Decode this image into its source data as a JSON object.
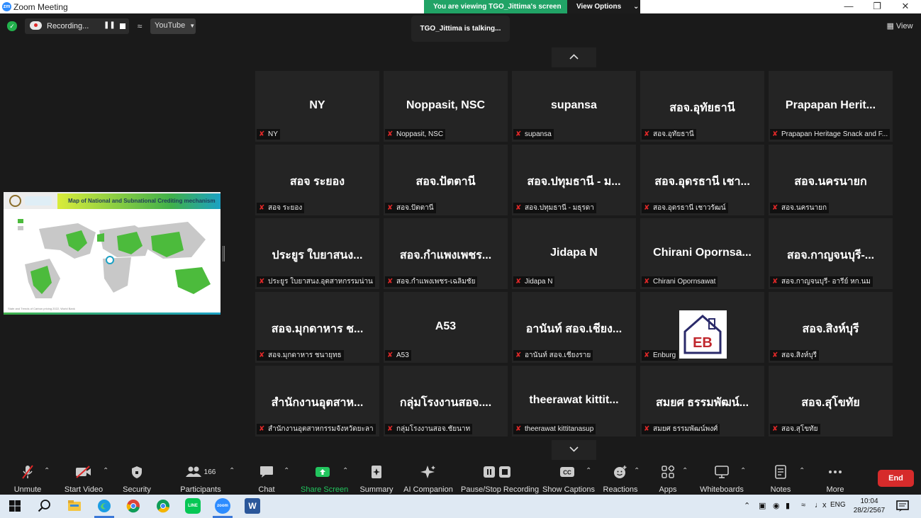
{
  "window": {
    "app_icon_text": "zm",
    "title": "Zoom Meeting"
  },
  "share_banner": {
    "message": "You are viewing TGO_Jittima's screen",
    "view_options": "View Options"
  },
  "recording": {
    "label": "Recording..."
  },
  "stream_target": {
    "label": "YouTube"
  },
  "talking_indicator": "TGO_Jittima is talking...",
  "view_button": "View",
  "shared_slide": {
    "title": "Map of National and Subnational Crediting mechanism",
    "footer": "State and Trends of Carbon pricing 2022, World Bank"
  },
  "participants_grid": [
    {
      "display": "NY",
      "name": "NY"
    },
    {
      "display": "Noppasit, NSC",
      "name": "Noppasit, NSC"
    },
    {
      "display": "supansa",
      "name": "supansa"
    },
    {
      "display": "สอจ.อุทัยธานี",
      "name": "สอจ.อุทัยธานี"
    },
    {
      "display": "Prapapan Herit...",
      "name": "Prapapan Heritage Snack and F..."
    },
    {
      "display": "สอจ ระยอง",
      "name": "สอจ ระยอง"
    },
    {
      "display": "สอจ.ปัตตานี",
      "name": "สอจ.ปัตตานี"
    },
    {
      "display": "สอจ.ปทุมธานี - ม...",
      "name": "สอจ.ปทุมธานี - มธุรดา"
    },
    {
      "display": "สอจ.อุดรธานี เชา...",
      "name": "สอจ.อุดรธานี เชาวรัฒน์"
    },
    {
      "display": "สอจ.นครนายก",
      "name": "สอจ.นครนายก"
    },
    {
      "display": "ประยูร ใบยาสนง...",
      "name": "ประยูร ใบยาสนง.อุตสาหกรรมน่าน"
    },
    {
      "display": "สอจ.กำแพงเพชร...",
      "name": "สอจ.กำแพงเพชร-เฉลิมชัย"
    },
    {
      "display": "Jidapa N",
      "name": "Jidapa N"
    },
    {
      "display": "Chirani Opornsa...",
      "name": "Chirani Opornsawat"
    },
    {
      "display": "สอจ.กาญจนบุรี-...",
      "name": "สอจ.กาญจนบุรี- อารีย์ หก.นม"
    },
    {
      "display": "สอจ.มุกดาหาร ช...",
      "name": "สอจ.มุกดาหาร ชนายุทธ"
    },
    {
      "display": "A53",
      "name": "A53"
    },
    {
      "display": "อานันท์ สอจ.เชียง...",
      "name": "อานันท์ สอจ.เชียงราย"
    },
    {
      "display": "",
      "name": "Enburg",
      "avatar": "EB"
    },
    {
      "display": "สอจ.สิงห์บุรี",
      "name": "สอจ.สิงห์บุรี"
    },
    {
      "display": "สำนักงานอุตสาห...",
      "name": "สำนักงานอุตสาหกรรมจังหวัดยะลา"
    },
    {
      "display": "กลุ่มโรงงานสอจ....",
      "name": "กลุ่มโรงงานสอจ.ชัยนาท"
    },
    {
      "display": "theerawat kittit...",
      "name": "theerawat kittitanasup"
    },
    {
      "display": "สมยศ ธรรมพัฒน์...",
      "name": "สมยศ ธรรมพัฒน์พงศ์"
    },
    {
      "display": "สอจ.สุโขทัย",
      "name": "สอจ.สุโขทัย"
    }
  ],
  "toolbar": {
    "unmute": "Unmute",
    "start_video": "Start Video",
    "security": "Security",
    "participants": "Participants",
    "participants_count": "166",
    "chat": "Chat",
    "share_screen": "Share Screen",
    "summary": "Summary",
    "ai_companion": "AI Companion",
    "pause_stop_recording": "Pause/Stop Recording",
    "show_captions": "Show Captions",
    "reactions": "Reactions",
    "apps": "Apps",
    "whiteboards": "Whiteboards",
    "notes": "Notes",
    "more": "More",
    "end": "End"
  },
  "taskbar": {
    "language": "ENG",
    "time": "10:04",
    "date": "28/2/2567",
    "zoom_icon_text": "zoom",
    "line_icon_text": "LINE",
    "word_icon_text": "W"
  },
  "colors": {
    "share_green": "#21a366",
    "end_red": "#d62b2b",
    "muted_red": "#e02828",
    "tile_bg": "#242424",
    "zoom_blue": "#2d8cff"
  }
}
